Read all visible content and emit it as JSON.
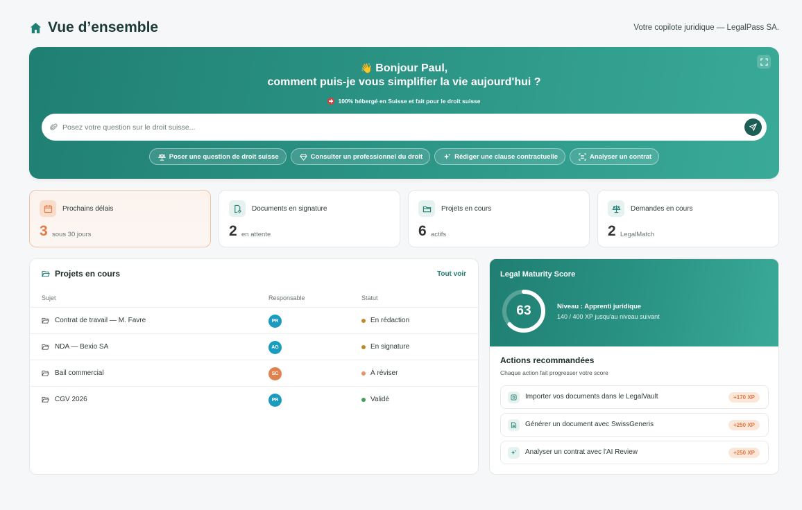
{
  "header": {
    "title": "Vue d’ensemble",
    "tagline": "Votre copilote juridique — LegalPass SA."
  },
  "hero": {
    "greeting_line1": "Bonjour Paul,",
    "greeting_line2": "comment puis-je vous simplifier la vie aujourd'hui ?",
    "hosted": "100% hébergé en Suisse et fait pour le droit suisse",
    "search_placeholder": "Posez votre question sur le droit suisse...",
    "chips": [
      {
        "label": "Poser une question de droit suisse",
        "icon": "scale-icon"
      },
      {
        "label": "Consulter un professionnel du droit",
        "icon": "diamond-icon"
      },
      {
        "label": "Rédiger une clause contractuelle",
        "icon": "sparkle-icon"
      },
      {
        "label": "Analyser un contrat",
        "icon": "scan-icon"
      }
    ]
  },
  "stats": [
    {
      "label": "Prochains délais",
      "value": "3",
      "sub": "sous 30 jours",
      "icon": "calendar-icon",
      "highlight": true
    },
    {
      "label": "Documents en signature",
      "value": "2",
      "sub": "en attente",
      "icon": "signature-icon"
    },
    {
      "label": "Projets en cours",
      "value": "6",
      "sub": "actifs",
      "icon": "folder-icon"
    },
    {
      "label": "Demandes en cours",
      "value": "2",
      "sub": "LegalMatch",
      "icon": "scale-icon"
    }
  ],
  "projects": {
    "title": "Projets en cours",
    "see_all": "Tout voir",
    "columns": [
      "Sujet",
      "Responsable",
      "Statut"
    ],
    "rows": [
      {
        "subject": "Contrat de travail — M. Favre",
        "initials": "PR",
        "avatar_color": "#1a9cc0",
        "status": "En rédaction",
        "status_color": "#c08a2a"
      },
      {
        "subject": "NDA — Bexio SA",
        "initials": "AG",
        "avatar_color": "#1a9cc0",
        "status": "En signature",
        "status_color": "#c08a2a"
      },
      {
        "subject": "Bail commercial",
        "initials": "SC",
        "avatar_color": "#e0824e",
        "status": "À réviser",
        "status_color": "#e89366"
      },
      {
        "subject": "CGV 2026",
        "initials": "PR",
        "avatar_color": "#1a9cc0",
        "status": "Validé",
        "status_color": "#3ea05a"
      }
    ]
  },
  "maturity": {
    "title": "Legal Maturity Score",
    "score": "63",
    "score_fraction": 0.63,
    "level": "Niveau : Apprenti juridique",
    "progress": "140 / 400 XP jusqu'au niveau suivant",
    "actions_title": "Actions recommandées",
    "actions_sub": "Chaque action fait progresser votre score",
    "actions": [
      {
        "label": "Importer vos documents dans le LegalVault",
        "xp": "+170 XP",
        "icon": "vault-icon"
      },
      {
        "label": "Générer un document avec SwissGeneris",
        "xp": "+250 XP",
        "icon": "document-icon"
      },
      {
        "label": "Analyser un contrat avec l'AI Review",
        "xp": "+250 XP",
        "icon": "sparkle-icon"
      }
    ]
  },
  "colors": {
    "brand": "#1f7f72",
    "accent_orange": "#e07b46"
  }
}
